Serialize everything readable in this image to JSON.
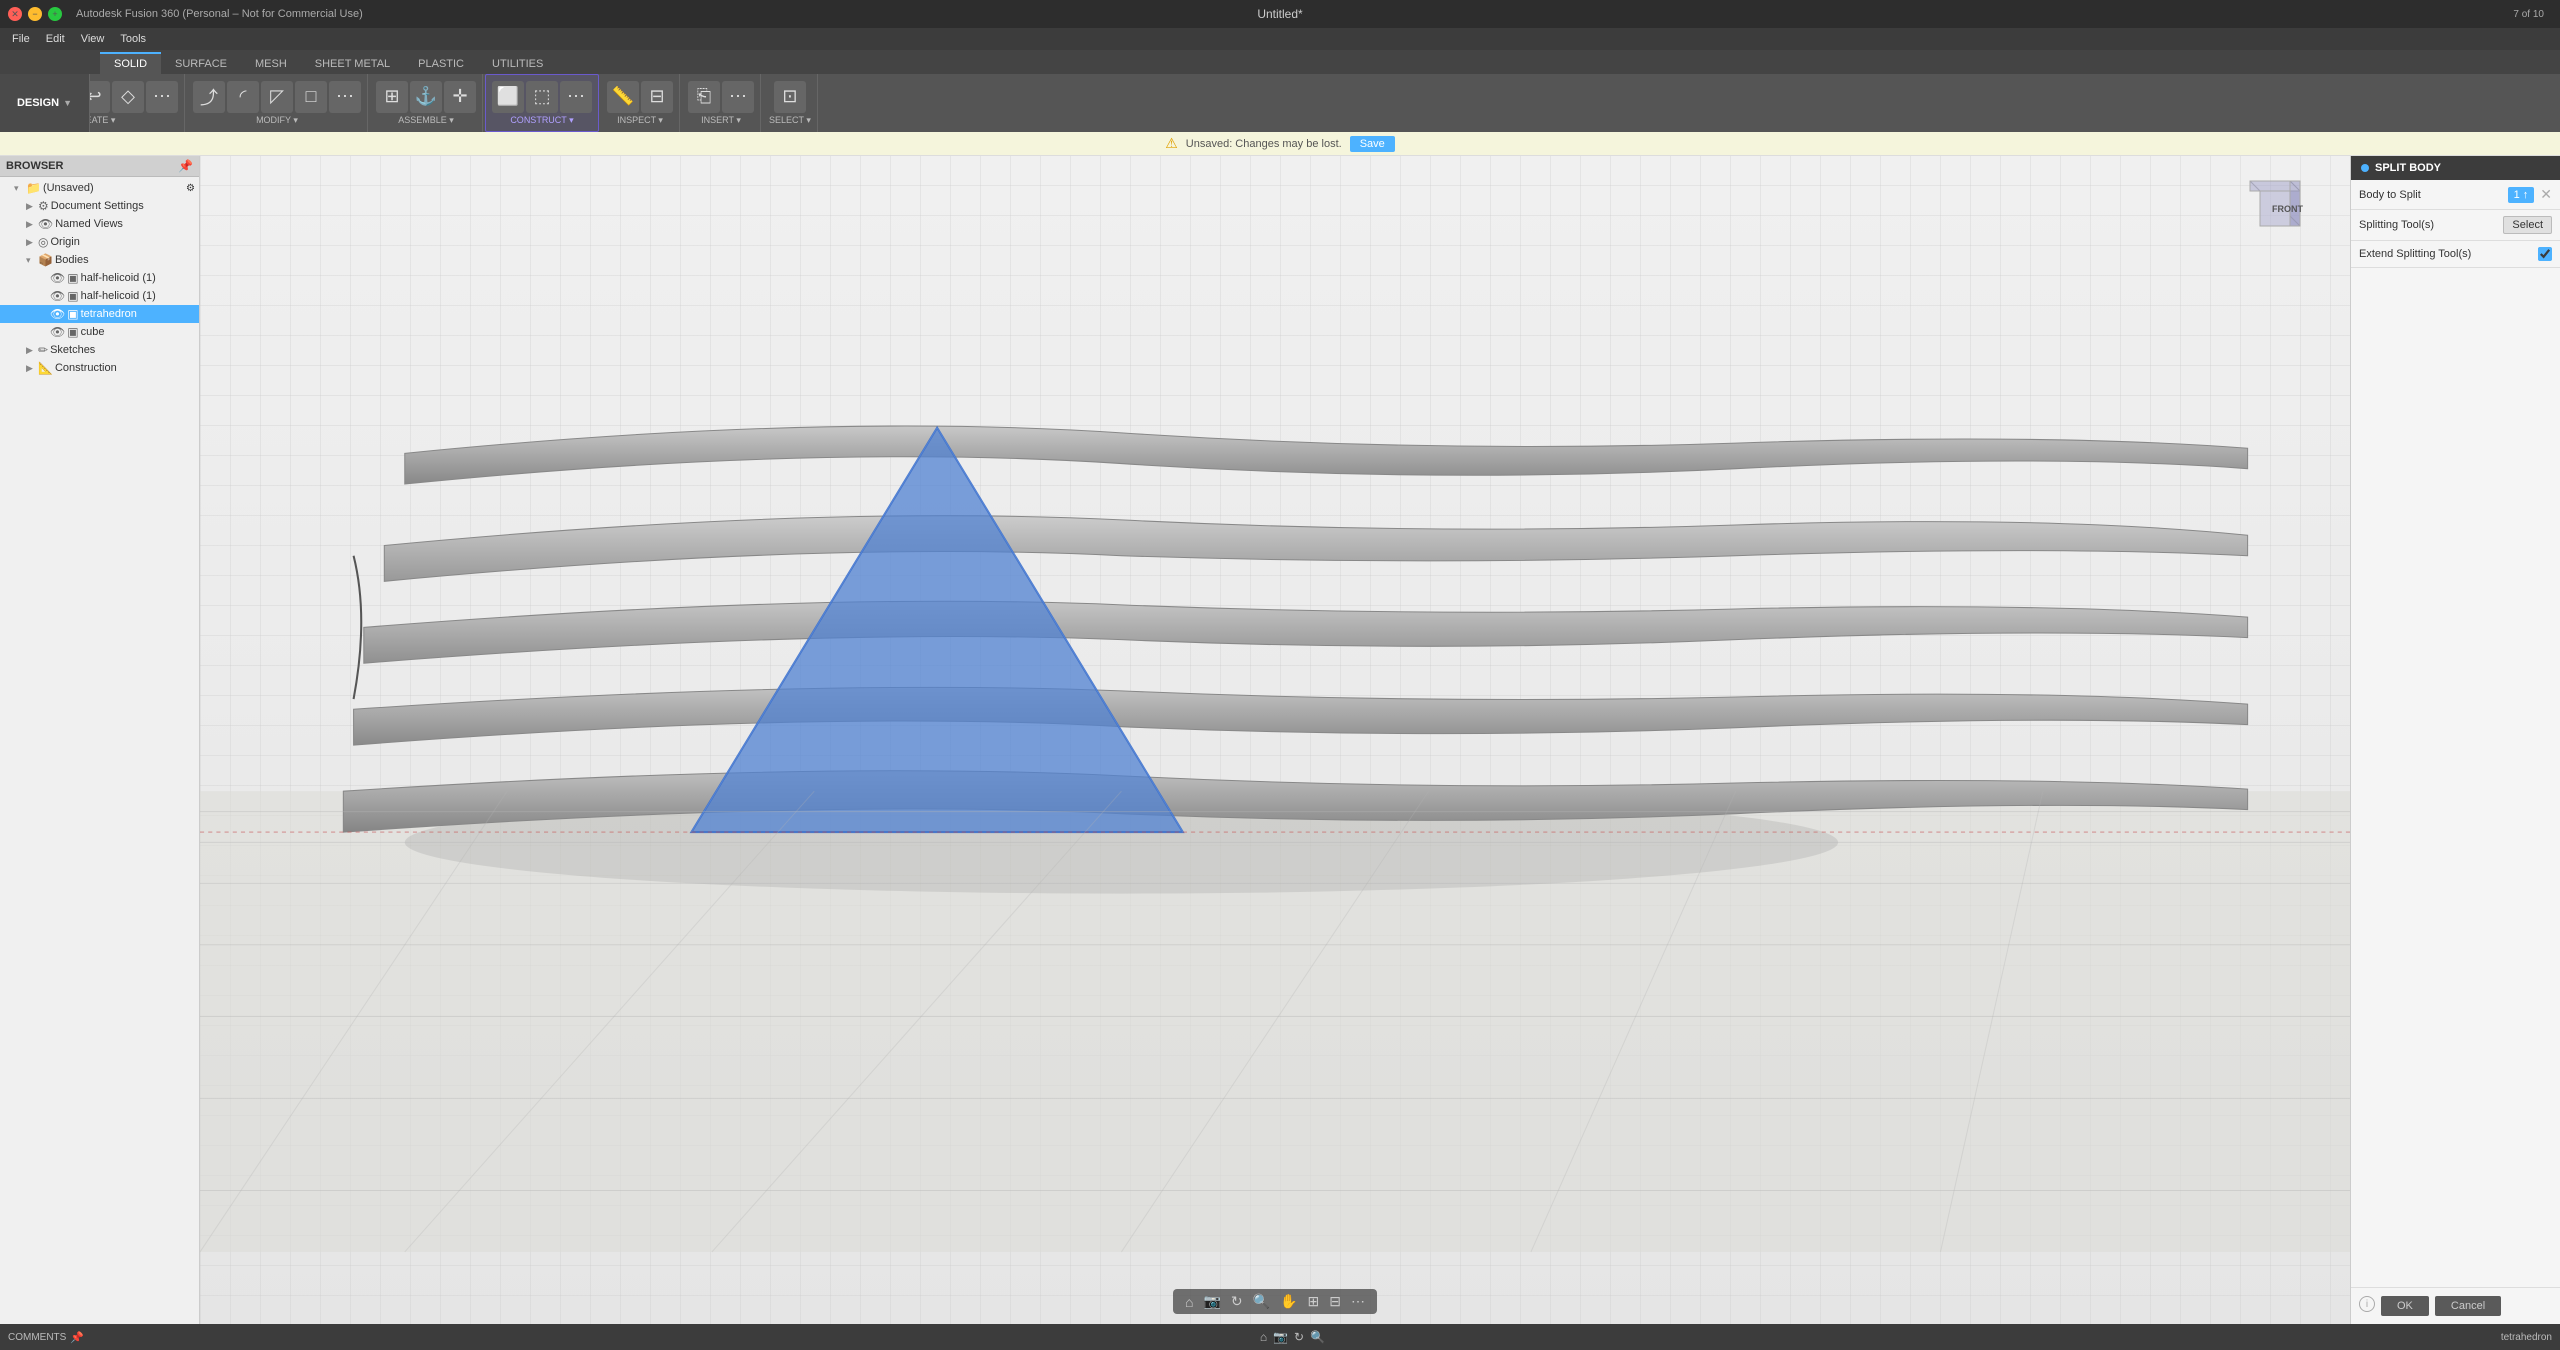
{
  "window": {
    "title": "Autodesk Fusion 360 (Personal – Not for Commercial Use)",
    "document_title": "Untitled*",
    "tab_info": "7 of 10"
  },
  "toolbar_tabs": {
    "active": "SOLID",
    "items": [
      "SOLID",
      "SURFACE",
      "MESH",
      "SHEET METAL",
      "PLASTIC",
      "UTILITIES"
    ]
  },
  "toolbar_sections": {
    "design_label": "DESIGN",
    "sections": [
      "CREATE",
      "MODIFY",
      "ASSEMBLE",
      "CONSTRUCT",
      "INSPECT",
      "INSERT",
      "SELECT"
    ]
  },
  "notification": {
    "icon": "⚠",
    "text": "Unsaved:  Changes may be lost.",
    "save_label": "Save"
  },
  "browser": {
    "header": "BROWSER",
    "items": [
      {
        "label": "(Unsaved)",
        "level": 0,
        "expanded": true,
        "icon": "📁"
      },
      {
        "label": "Document Settings",
        "level": 1,
        "icon": "⚙"
      },
      {
        "label": "Named Views",
        "level": 1,
        "icon": "👁"
      },
      {
        "label": "Origin",
        "level": 1,
        "icon": "◎"
      },
      {
        "label": "Bodies",
        "level": 1,
        "expanded": true,
        "icon": "📦"
      },
      {
        "label": "half-helicoid (1)",
        "level": 2,
        "icon": "▣"
      },
      {
        "label": "half-helicoid (1)",
        "level": 2,
        "icon": "▣"
      },
      {
        "label": "tetrahedron",
        "level": 2,
        "icon": "▣",
        "selected": true
      },
      {
        "label": "cube",
        "level": 2,
        "icon": "▣"
      },
      {
        "label": "Sketches",
        "level": 1,
        "icon": "✏"
      },
      {
        "label": "Construction",
        "level": 1,
        "icon": "📐"
      }
    ]
  },
  "split_body_panel": {
    "title": "SPLIT BODY",
    "body_to_split_label": "Body to Split",
    "body_to_split_value": "1 ↑",
    "splitting_tools_label": "Splitting Tool(s)",
    "select_label": "Select",
    "extend_splitting_label": "Extend Splitting Tool(s)",
    "ok_label": "OK",
    "cancel_label": "Cancel"
  },
  "view_cube": {
    "face_label": "FRONT ☐"
  },
  "bottom_bar": {
    "comments_label": "COMMENTS",
    "body_label": "tetrahedron"
  },
  "viewport": {
    "background_top": "#efefef",
    "background_bottom": "#e0e0e0"
  }
}
